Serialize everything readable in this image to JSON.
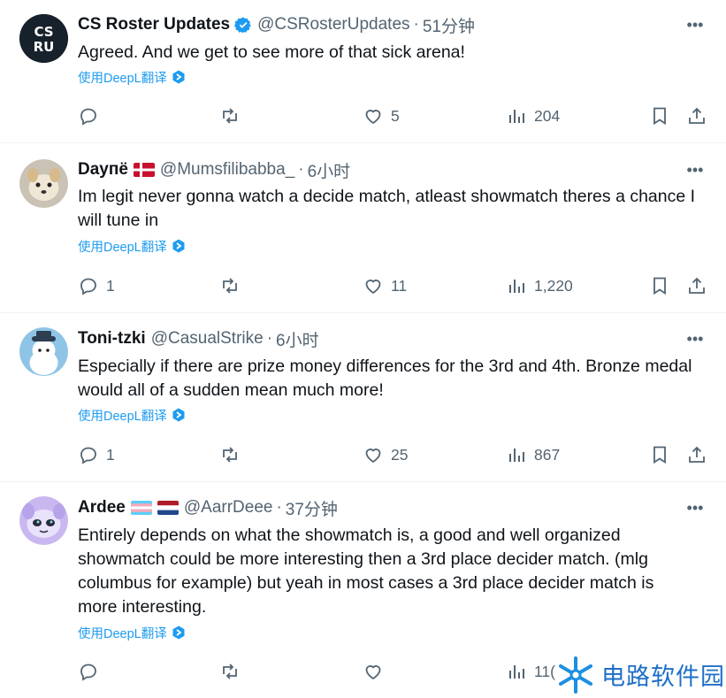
{
  "colors": {
    "accent": "#1d9bf0",
    "muted": "#536471",
    "text": "#0f1419"
  },
  "translate_label": "使用DeepL翻译",
  "tweets": [
    {
      "name": "CS Roster Updates",
      "handle": "@CSRosterUpdates",
      "sep": "·",
      "time": "51分钟",
      "verified": true,
      "text": "Agreed. And we get to see more of that sick arena!",
      "replies": "",
      "retweets": "",
      "likes": "5",
      "views": "204"
    },
    {
      "name": "Dayпё",
      "handle": "@Mumsfilibabba_",
      "sep": "·",
      "time": "6小时",
      "flags": [
        "denmark-flag"
      ],
      "text": "Im legit never gonna watch a decide match, atleast showmatch theres a chance I will tune in",
      "replies": "1",
      "retweets": "",
      "likes": "11",
      "views": "1,220"
    },
    {
      "name": "Toni-tzki",
      "handle": "@CasualStrike",
      "sep": "·",
      "time": "6小时",
      "text": "Especially if there are prize money differences for the 3rd and 4th. Bronze medal would all of a sudden mean much more!",
      "replies": "1",
      "retweets": "",
      "likes": "25",
      "views": "867"
    },
    {
      "name": "Ardee",
      "handle": "@AarrDeee",
      "sep": "·",
      "time": "37分钟",
      "flags": [
        "transgender-flag",
        "netherlands-flag"
      ],
      "text": "Entirely depends on what the showmatch is, a good and well organized showmatch could be more interesting then a 3rd place decider match. (mlg columbus for example) but yeah in most cases a 3rd place decider match is more interesting.",
      "replies": "",
      "retweets": "",
      "likes": "",
      "views": "11("
    }
  ],
  "watermark": {
    "text": "电路软件园"
  }
}
